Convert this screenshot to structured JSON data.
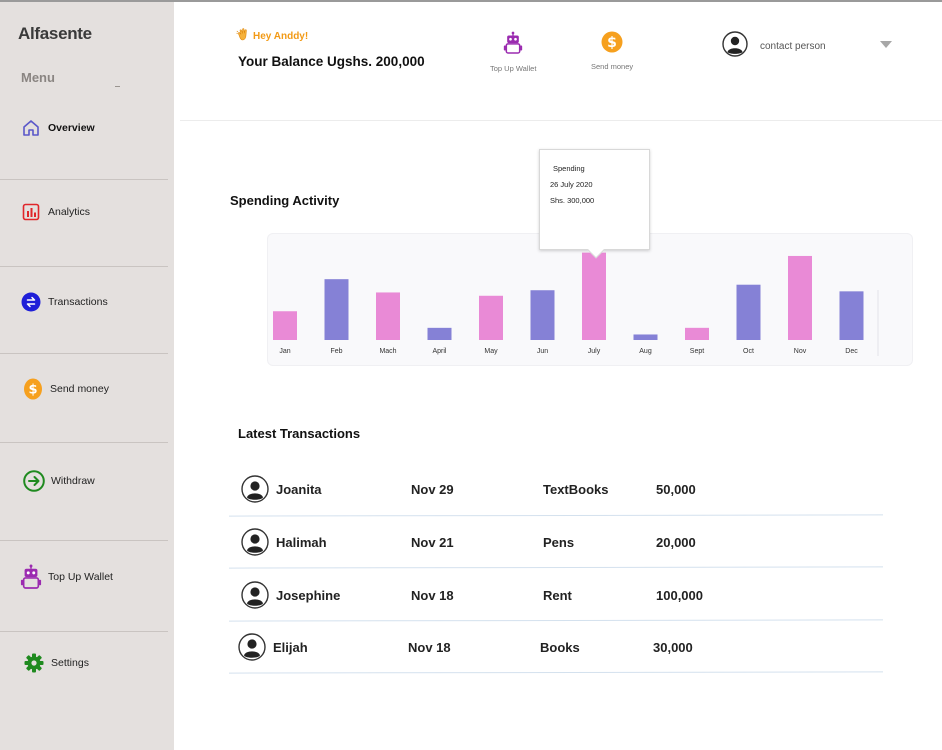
{
  "brand": "Alfasente",
  "sidebar": {
    "menu_label": "Menu",
    "items": [
      {
        "label": "Overview",
        "icon": "home-icon"
      },
      {
        "label": "Analytics",
        "icon": "bar-chart-icon"
      },
      {
        "label": "Transactions",
        "icon": "exchange-icon"
      },
      {
        "label": "Send money",
        "icon": "dollar-coin-icon"
      },
      {
        "label": "Withdraw",
        "icon": "arrow-circle-icon"
      },
      {
        "label": "Top Up Wallet",
        "icon": "robot-icon"
      },
      {
        "label": "Settings",
        "icon": "gear-icon"
      }
    ]
  },
  "header": {
    "greeting": "Hey Anddy!",
    "balance": "Your Balance Ugshs. 200,000",
    "top_up_label": "Top Up Wallet",
    "send_money_label": "Send money",
    "contact_label": "contact person"
  },
  "spending": {
    "title": "Spending Activity",
    "tooltip": {
      "title": "Spending",
      "date": "26 July 2020",
      "amount": "Shs. 300,000"
    }
  },
  "chart_data": {
    "type": "bar",
    "categories": [
      "Jan",
      "Feb",
      "Mach",
      "April",
      "May",
      "Jun",
      "July",
      "Aug",
      "Sept",
      "Oct",
      "Nov",
      "Dec"
    ],
    "values": [
      26,
      55,
      43,
      11,
      40,
      45,
      79,
      5,
      11,
      50,
      76,
      44
    ],
    "bar_colors": [
      "#e98ad6",
      "#8581d6",
      "#e98ad6",
      "#8581d6",
      "#e98ad6",
      "#8581d6",
      "#e98ad6",
      "#8581d6",
      "#e98ad6",
      "#8581d6",
      "#e98ad6",
      "#8581d6"
    ],
    "highlighted": "July",
    "grid": false,
    "ylim": [
      0,
      85
    ]
  },
  "transactions": {
    "title": "Latest Transactions",
    "rows": [
      {
        "name": "Joanita",
        "date": "Nov 29",
        "item": "TextBooks",
        "amount": "50,000"
      },
      {
        "name": "Halimah",
        "date": "Nov 21",
        "item": "Pens",
        "amount": "20,000"
      },
      {
        "name": "Josephine",
        "date": "Nov 18",
        "item": "Rent",
        "amount": "100,000"
      },
      {
        "name": "Elijah",
        "date": "Nov 18",
        "item": "Books",
        "amount": "30,000"
      }
    ]
  },
  "colors": {
    "sidebar_bg": "#e4e0de",
    "accent_orange": "#f29a16",
    "accent_purple": "#8581d6",
    "accent_pink": "#e98ad6",
    "top_up_purple": "#9b2bb0"
  }
}
